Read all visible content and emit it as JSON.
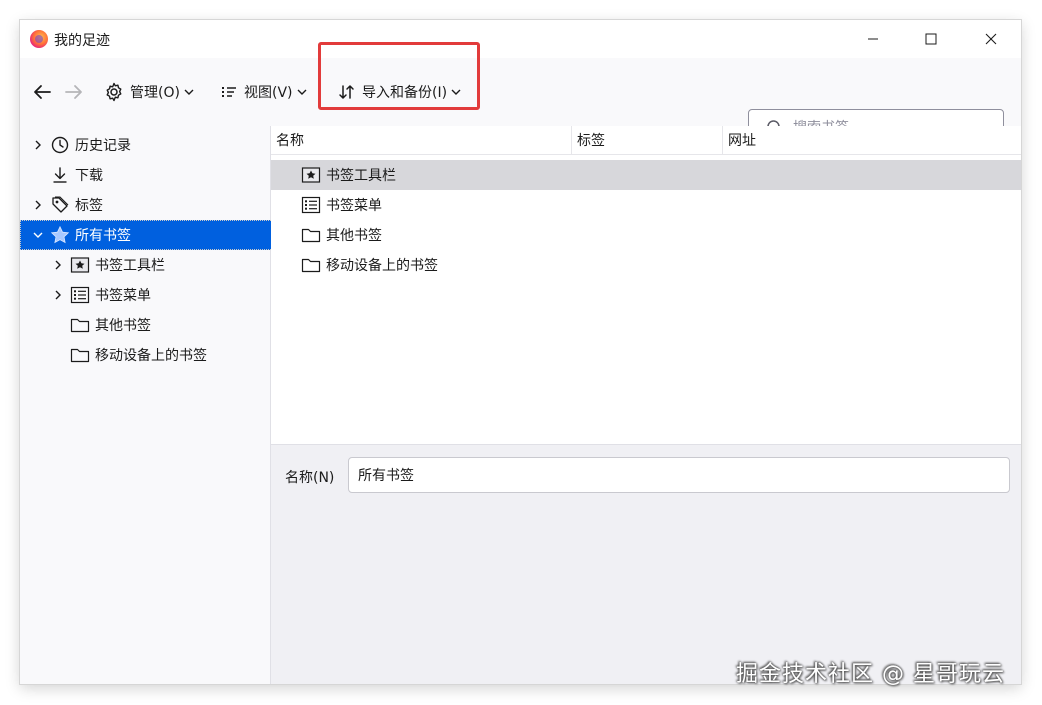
{
  "window": {
    "title": "我的足迹",
    "controls": {
      "minimize": "—",
      "maximize": "☐",
      "close": "✕"
    }
  },
  "toolbar": {
    "organize_label": "管理(O)",
    "views_label": "视图(V)",
    "import_backup_label": "导入和备份(I)",
    "search_placeholder": "搜索书签",
    "highlight_color": "#e23b3b"
  },
  "sidebar": {
    "items": [
      {
        "label": "历史记录",
        "icon": "clock-icon",
        "expandable": true
      },
      {
        "label": "下载",
        "icon": "download-icon",
        "expandable": false
      },
      {
        "label": "标签",
        "icon": "tag-icon",
        "expandable": true
      },
      {
        "label": "所有书签",
        "icon": "star-icon",
        "expandable": true,
        "expanded": true,
        "selected": true
      },
      {
        "label": "书签工具栏",
        "icon": "bookmark-toolbar-icon",
        "expandable": true
      },
      {
        "label": "书签菜单",
        "icon": "bookmark-menu-icon",
        "expandable": true
      },
      {
        "label": "其他书签",
        "icon": "folder-icon",
        "expandable": false
      },
      {
        "label": "移动设备上的书签",
        "icon": "folder-icon",
        "expandable": false
      }
    ]
  },
  "list": {
    "columns": [
      "名称",
      "标签",
      "网址"
    ],
    "rows": [
      {
        "name": "书签工具栏",
        "icon": "bookmark-toolbar-icon",
        "current": true
      },
      {
        "name": "书签菜单",
        "icon": "bookmark-menu-icon"
      },
      {
        "name": "其他书签",
        "icon": "folder-icon"
      },
      {
        "name": "移动设备上的书签",
        "icon": "folder-icon"
      }
    ]
  },
  "details": {
    "name_label": "名称(N)",
    "name_value": "所有书签"
  },
  "watermark": "掘金技术社区 @ 星哥玩云",
  "colors": {
    "selection": "#0060df",
    "current_row": "#d7d7db"
  }
}
